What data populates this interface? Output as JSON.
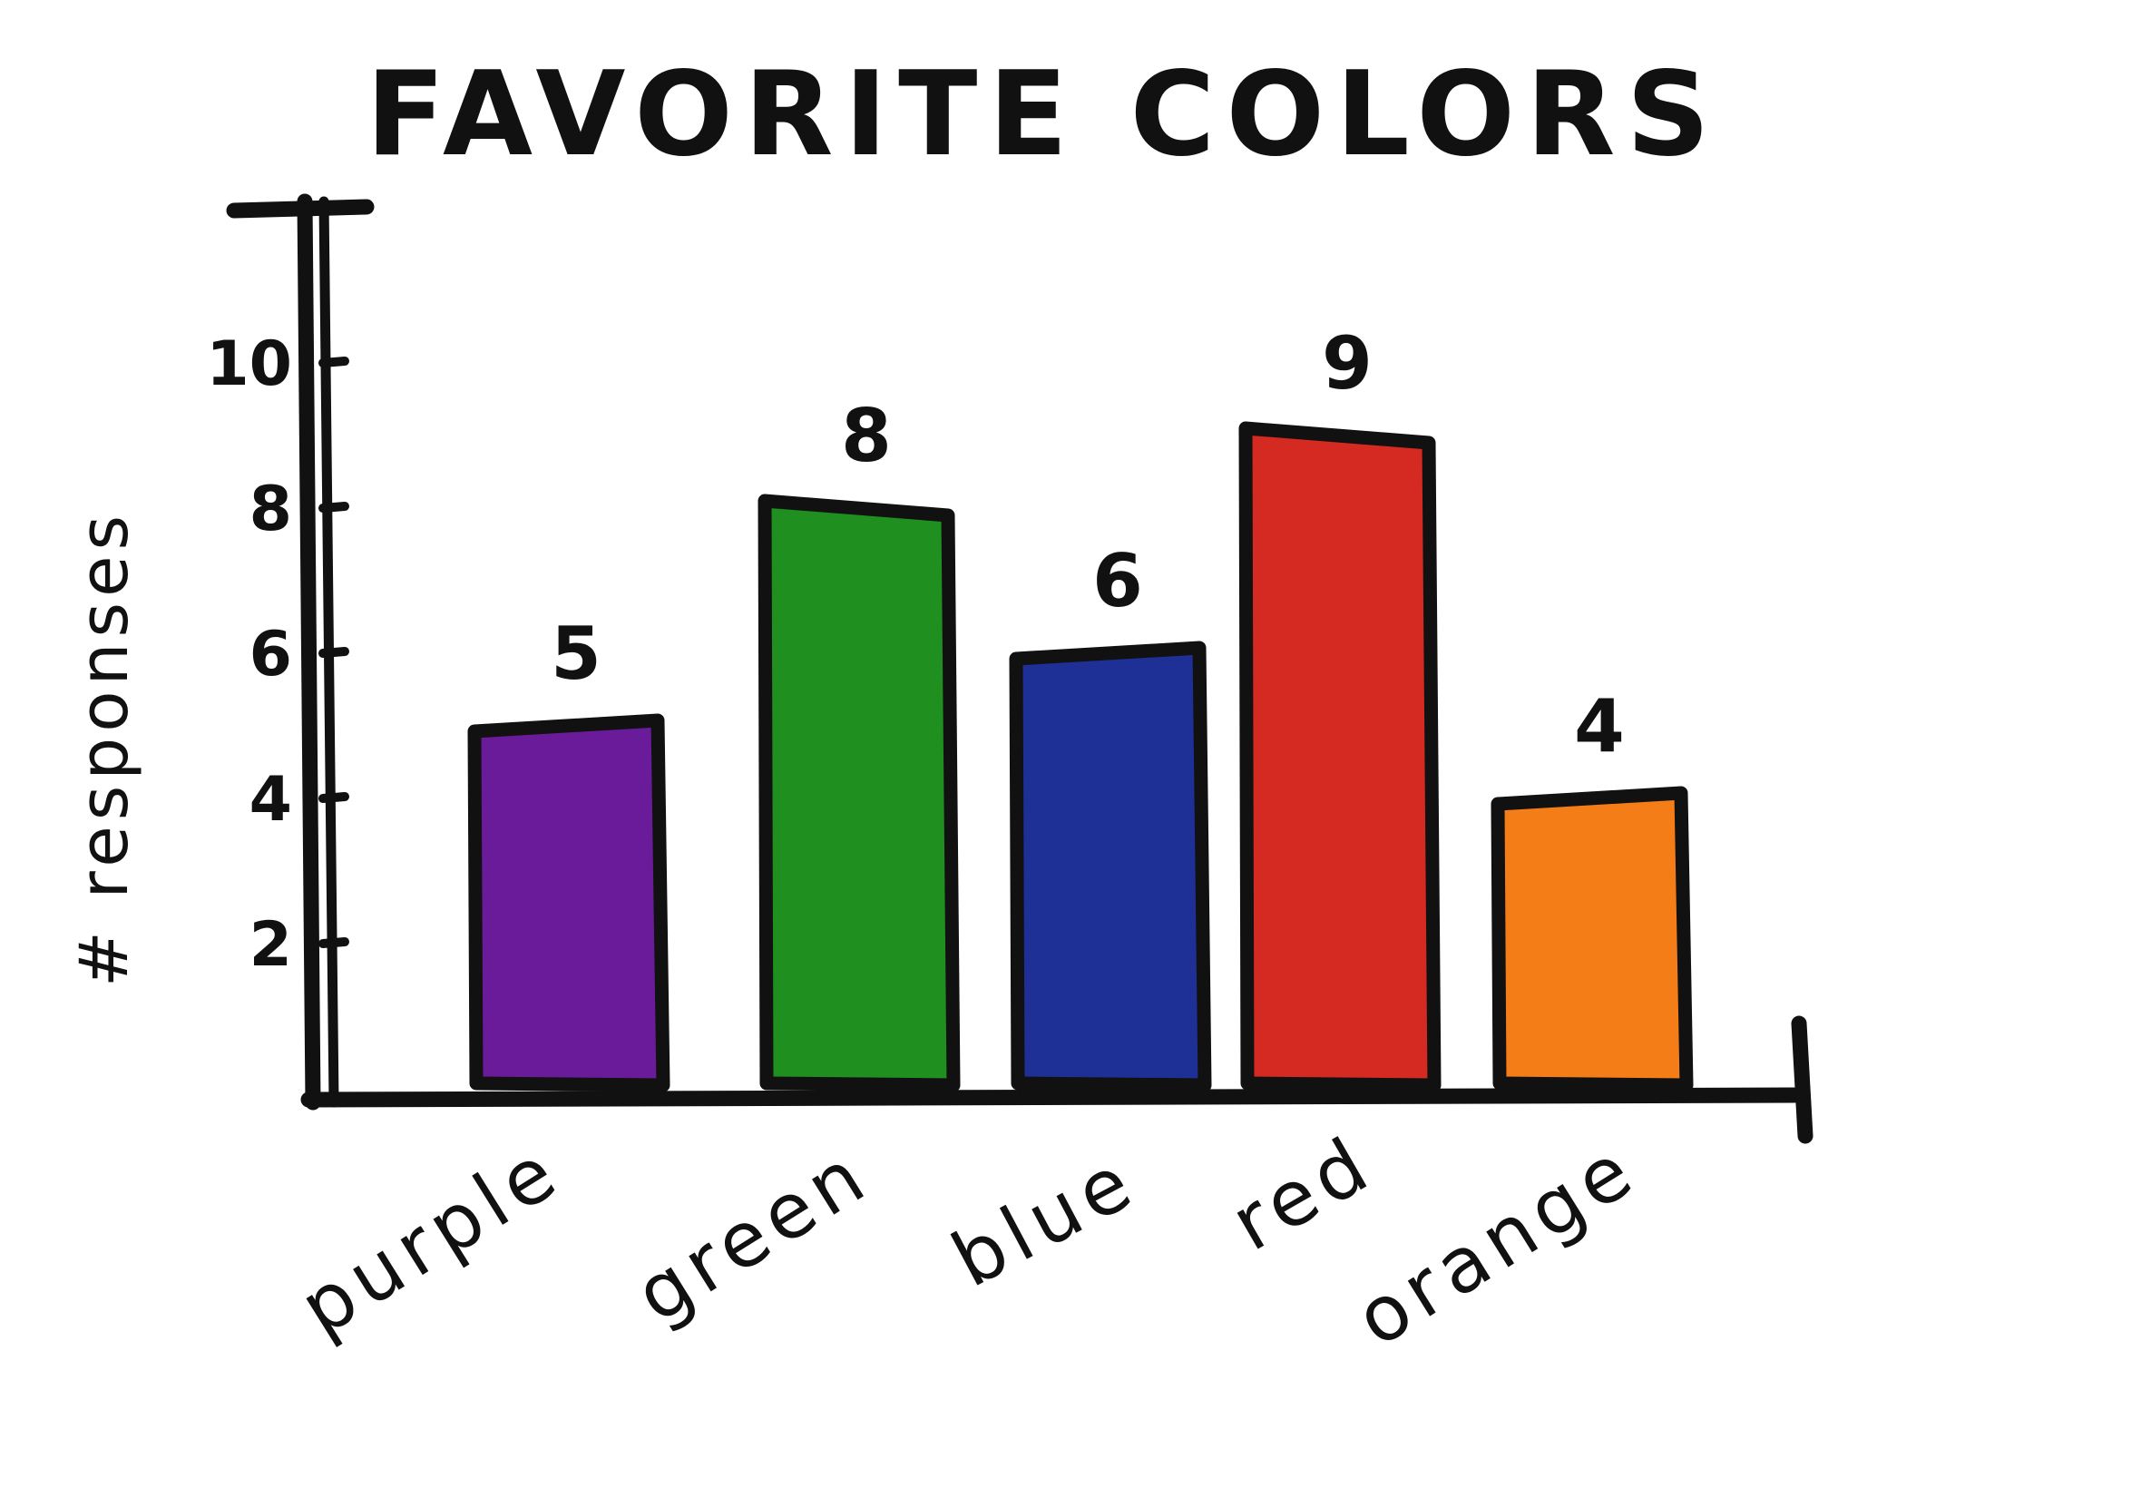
{
  "chart_data": {
    "type": "bar",
    "title": "FAVORITE COLORS",
    "xlabel": "",
    "ylabel": "# responses",
    "categories": [
      "purple",
      "green",
      "blue",
      "red",
      "orange"
    ],
    "values": [
      5,
      8,
      6,
      9,
      4
    ],
    "bar_colors": [
      "#6a1b9a",
      "#1f8f1f",
      "#1e2f96",
      "#d42a22",
      "#f57d17"
    ],
    "yticks": [
      2,
      4,
      6,
      8,
      10
    ],
    "ylim": [
      0,
      12
    ],
    "grid": false,
    "legend": "none"
  }
}
